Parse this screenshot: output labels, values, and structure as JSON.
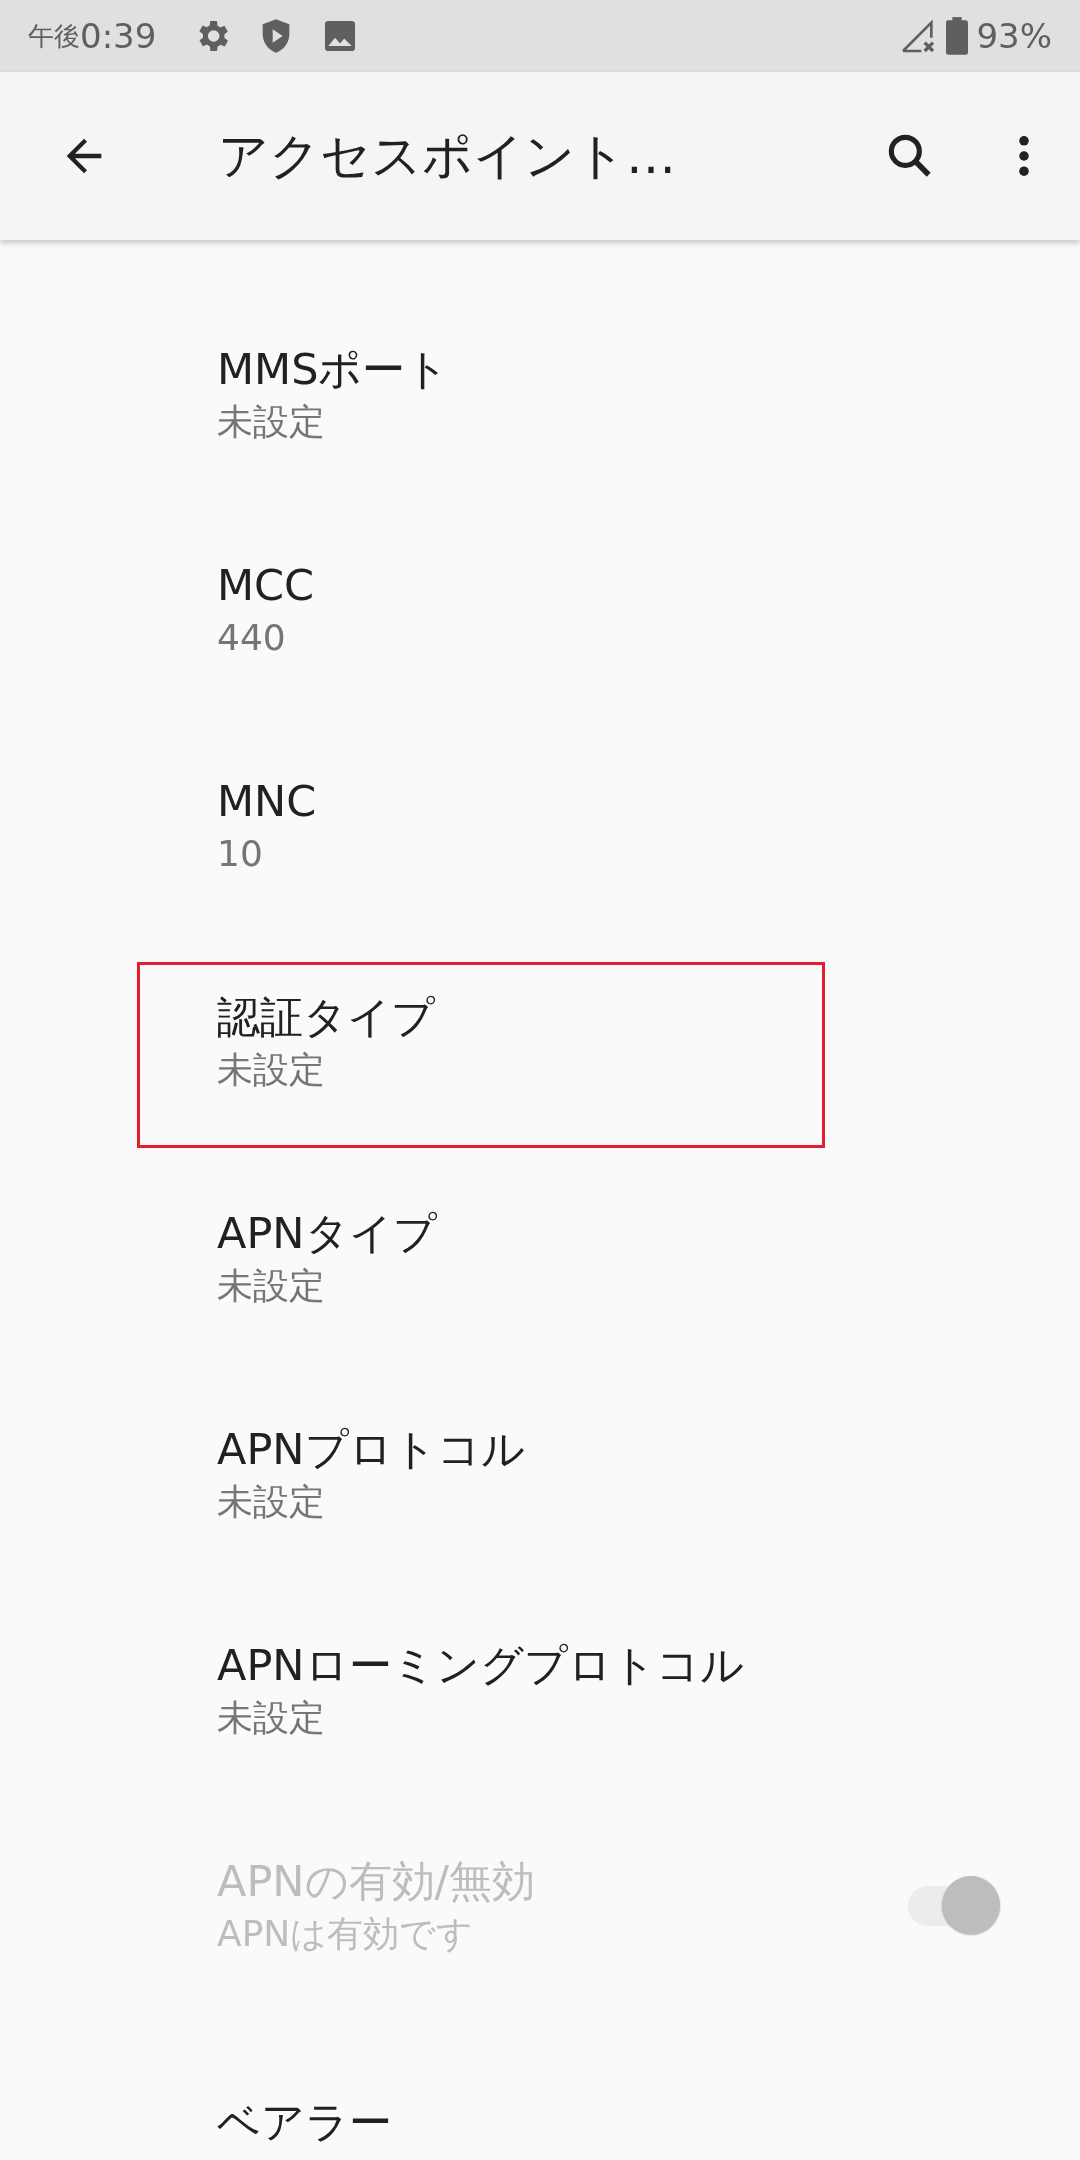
{
  "status_bar": {
    "time_prefix": "午後",
    "time": "0:39",
    "battery": "93%"
  },
  "toolbar": {
    "title": "アクセスポイント…"
  },
  "items": [
    {
      "kind": "text",
      "title": "MMSポート",
      "summary": "未設定",
      "highlighted": false,
      "disabled": false
    },
    {
      "kind": "text",
      "title": "MCC",
      "summary": "440",
      "highlighted": false,
      "disabled": false
    },
    {
      "kind": "text",
      "title": "MNC",
      "summary": "10",
      "highlighted": false,
      "disabled": false
    },
    {
      "kind": "text",
      "title": "認証タイプ",
      "summary": "未設定",
      "highlighted": true,
      "disabled": false
    },
    {
      "kind": "text",
      "title": "APNタイプ",
      "summary": "未設定",
      "highlighted": false,
      "disabled": false
    },
    {
      "kind": "text",
      "title": "APNプロトコル",
      "summary": "未設定",
      "highlighted": false,
      "disabled": false
    },
    {
      "kind": "text",
      "title": "APNローミングプロトコル",
      "summary": "未設定",
      "highlighted": false,
      "disabled": false
    },
    {
      "kind": "switch",
      "title": "APNの有効/無効",
      "summary": "APNは有効です",
      "highlighted": false,
      "disabled": true,
      "on": true
    },
    {
      "kind": "text",
      "title": "ベアラー",
      "highlighted": false,
      "disabled": false
    }
  ]
}
